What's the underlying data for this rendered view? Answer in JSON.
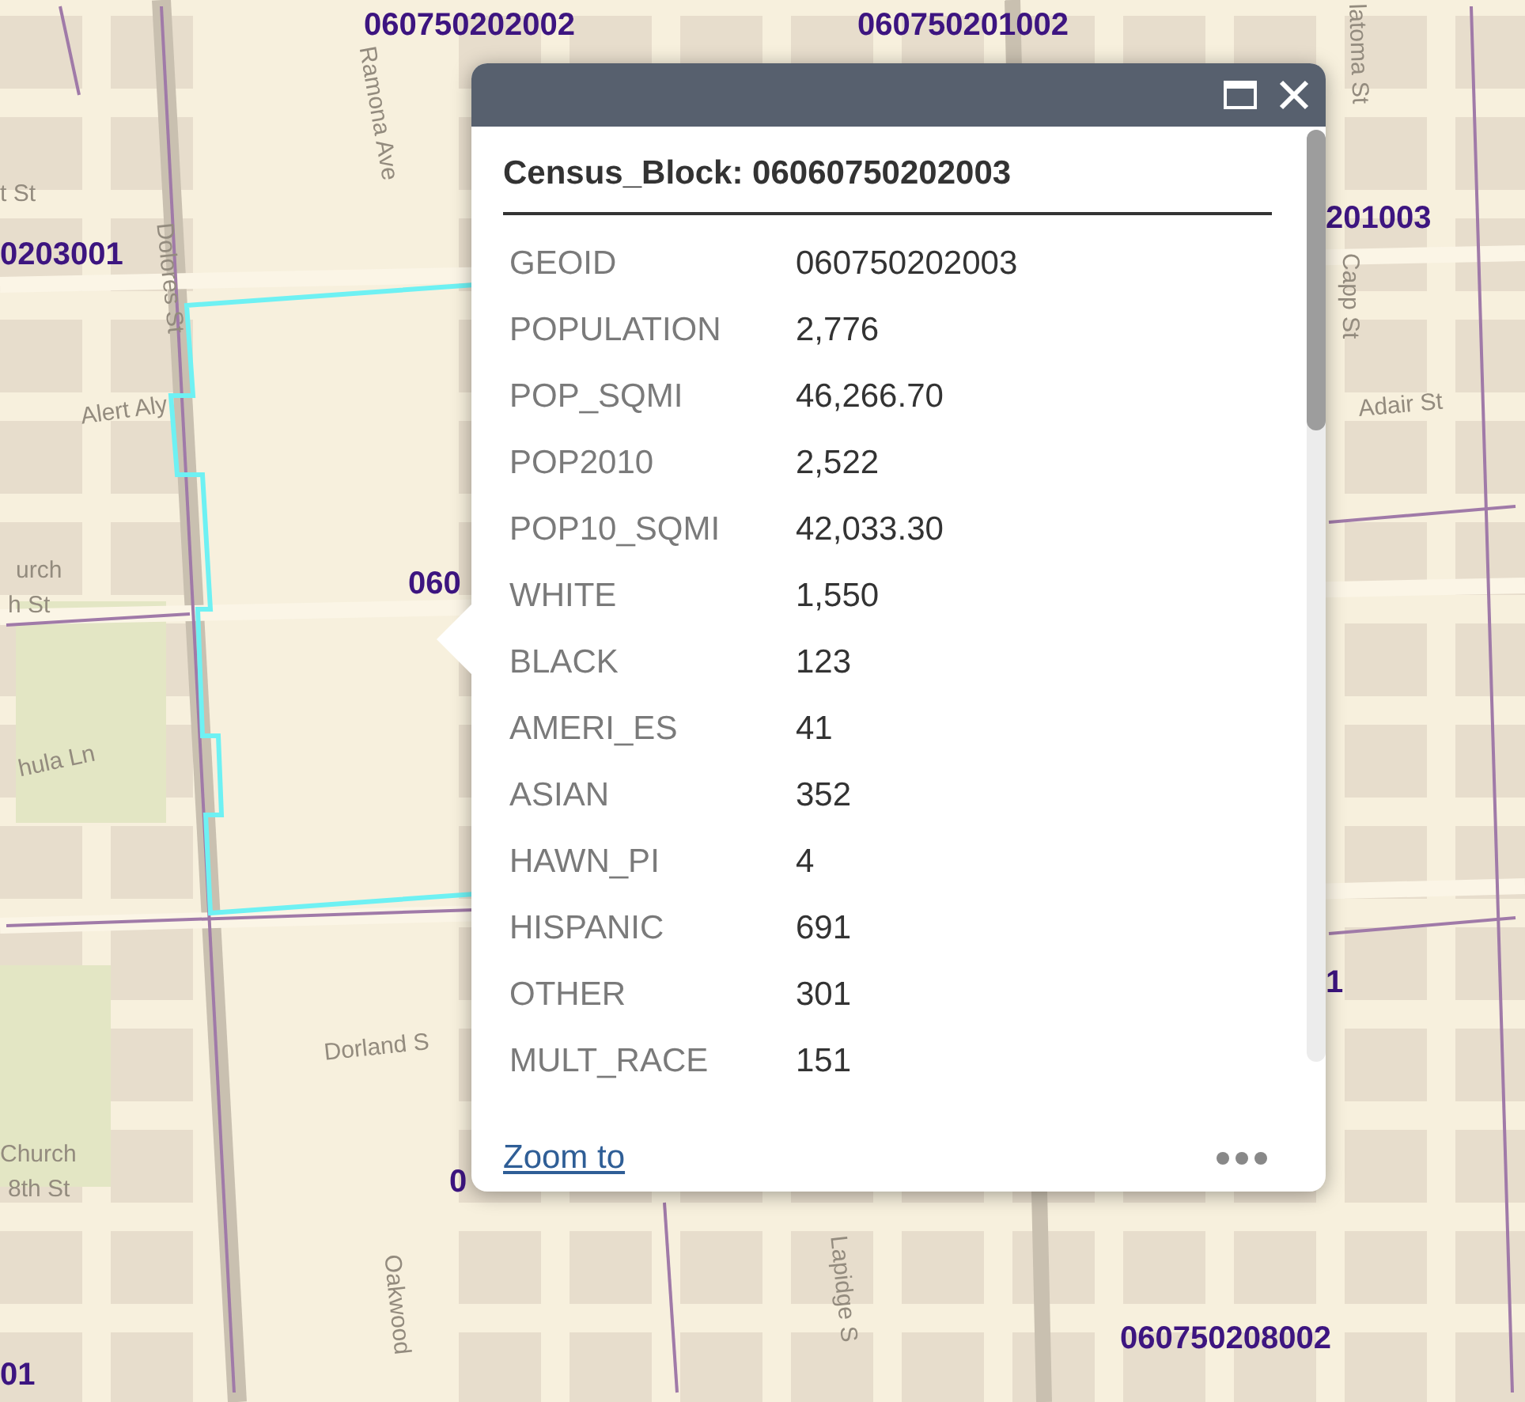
{
  "map": {
    "block_labels": [
      "060750202002",
      "060750201002",
      "0203001",
      "201003",
      "060",
      "1",
      "0",
      "060750208002",
      "01"
    ],
    "street_labels": [
      "Dolores St",
      "Ramona Ave",
      "Alert Aly",
      "hula Ln",
      "Dorland S",
      "Oakwood",
      "Lapidge S",
      "Capp St",
      "Adair St",
      "latoma St",
      "t St",
      "urch",
      "h St",
      "Church",
      "8th St"
    ]
  },
  "popup": {
    "title": "Census_Block: 06060750202003",
    "fields": [
      {
        "label": "GEOID",
        "value": "060750202003"
      },
      {
        "label": "POPULATION",
        "value": "2,776"
      },
      {
        "label": "POP_SQMI",
        "value": "46,266.70"
      },
      {
        "label": "POP2010",
        "value": "2,522"
      },
      {
        "label": "POP10_SQMI",
        "value": "42,033.30"
      },
      {
        "label": "WHITE",
        "value": "1,550"
      },
      {
        "label": "BLACK",
        "value": "123"
      },
      {
        "label": "AMERI_ES",
        "value": "41"
      },
      {
        "label": "ASIAN",
        "value": "352"
      },
      {
        "label": "HAWN_PI",
        "value": "4"
      },
      {
        "label": "HISPANIC",
        "value": "691"
      },
      {
        "label": "OTHER",
        "value": "301"
      },
      {
        "label": "MULT_RACE",
        "value": "151"
      }
    ],
    "link": "Zoom to"
  }
}
